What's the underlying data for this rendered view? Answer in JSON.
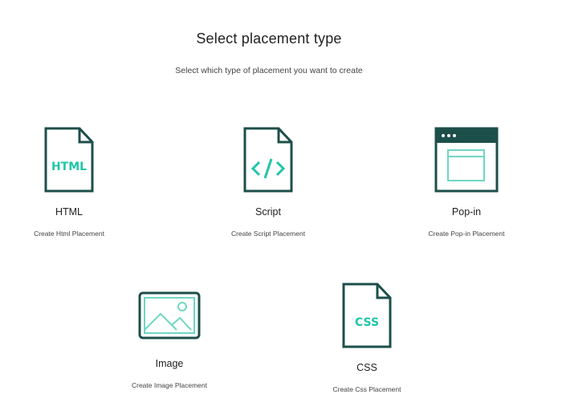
{
  "header": {
    "title": "Select placement type",
    "subtitle": "Select which type of placement you want to create"
  },
  "colors": {
    "icon_dark": "#1d4f4a",
    "icon_accent": "#1fc6a8",
    "icon_light": "#6fd6c3"
  },
  "placements": [
    {
      "label": "HTML",
      "description": "Create Html Placement",
      "icon": "html-file-icon",
      "icon_text": "HTML"
    },
    {
      "label": "Script",
      "description": "Create Script Placement",
      "icon": "code-file-icon",
      "icon_text": "</>"
    },
    {
      "label": "Pop-in",
      "description": "Create Pop-in Placement",
      "icon": "browser-window-icon"
    },
    {
      "label": "Image",
      "description": "Create Image Placement",
      "icon": "image-icon"
    },
    {
      "label": "CSS",
      "description": "Create Css Placement",
      "icon": "css-file-icon",
      "icon_text": "CSS"
    }
  ]
}
